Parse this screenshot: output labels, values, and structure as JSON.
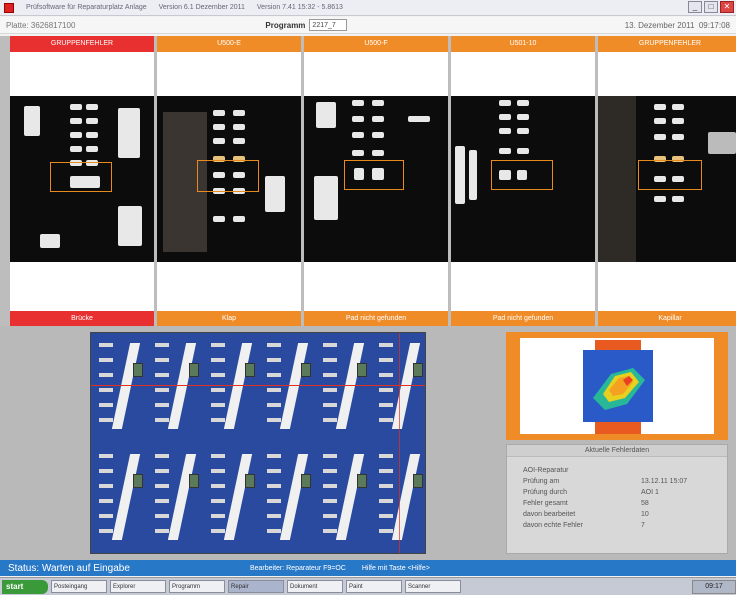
{
  "window": {
    "title_parts": [
      "Prüfsoftware für Reparaturplatz Anlage",
      "Version 6.1 Dezember 2011",
      "Version 7.41 15:32 - 5.8613"
    ],
    "min": "_",
    "max": "□",
    "close": "✕"
  },
  "infobar": {
    "left_text": "Platte: 3626817100",
    "program_label": "Programm",
    "program_value": "2217_7",
    "date": "13. Dezember 2011",
    "time": "09:17:08"
  },
  "panels": [
    {
      "header": "GRUPPENFEHLER",
      "header_color": "#e83030",
      "footer": "Brücke",
      "footer_color": "#e83030"
    },
    {
      "header": "U500-E",
      "header_color": "#f08c28",
      "footer": "Klap",
      "footer_color": "#f08c28"
    },
    {
      "header": "U500-F",
      "header_color": "#f08c28",
      "footer": "Pad nicht gefunden",
      "footer_color": "#f08c28"
    },
    {
      "header": "U501-10",
      "header_color": "#f08c28",
      "footer": "Pad nicht gefunden",
      "footer_color": "#f08c28"
    },
    {
      "header": "GRUPPENFEHLER",
      "header_color": "#f08c28",
      "footer": "Kapillar",
      "footer_color": "#f08c28"
    }
  ],
  "results": {
    "title": "Aktuelle Fehlerdaten",
    "rows": [
      {
        "key": "AOI-Reparatur",
        "value": ""
      },
      {
        "key": "Prüfung am",
        "value": "13.12.11 15:07"
      },
      {
        "key": "Prüfung durch",
        "value": "AOI 1"
      },
      {
        "key": "Fehler gesamt",
        "value": "58"
      },
      {
        "key": "davon bearbeitet",
        "value": "10"
      },
      {
        "key": "davon echte Fehler",
        "value": "7"
      }
    ]
  },
  "status": {
    "text": "Status: Warten auf Eingabe",
    "hint_1": "Bearbeiter: Reparateur  F9=OC",
    "hint_2": "Hilfe mit Taste <Hilfe>"
  },
  "taskbar": {
    "start": "start",
    "buttons": [
      "Posteingang",
      "Explorer",
      "Programm",
      "Repair",
      "Dokument",
      "Paint",
      "Scanner"
    ],
    "clock": "09:17"
  }
}
